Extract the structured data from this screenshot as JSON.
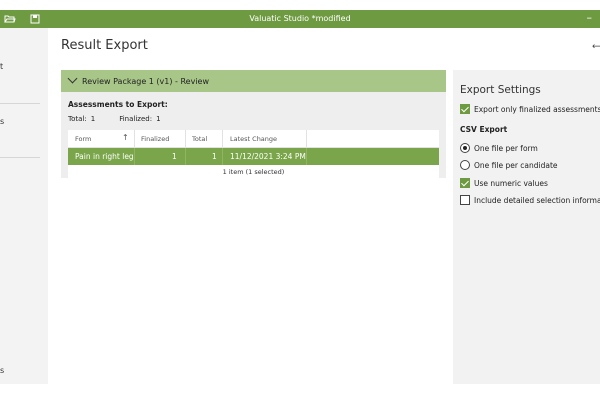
{
  "titlebar": {
    "title": "Valuatic Studio  *modified",
    "open_icon": "folder-open-icon",
    "save_icon": "save-icon",
    "minimize": "–"
  },
  "sidebar": {
    "fragments": [
      "t",
      "s",
      "s"
    ]
  },
  "main": {
    "page_title": "Result Export",
    "back_glyph": "⟵",
    "package": {
      "header": "Review Package 1 (v1) - Review",
      "assessments_label": "Assessments to Export:",
      "total_label": "Total:",
      "total_value": "1",
      "finalized_label": "Finalized:",
      "finalized_value": "1",
      "table": {
        "columns": [
          "Form",
          "Finalized",
          "Total",
          "Latest Change"
        ],
        "sort_indicator": "↑",
        "rows": [
          {
            "form": "Pain in right leg",
            "finalized": "1",
            "total": "1",
            "latest_change": "11/12/2021 3:24 PM"
          }
        ],
        "status": "1 item (1 selected)"
      }
    }
  },
  "export_settings": {
    "title": "Export Settings",
    "only_finalized": {
      "label": "Export only finalized assessments",
      "checked": true
    },
    "csv_heading": "CSV Export",
    "one_file_per_form": {
      "label": "One file per form",
      "selected": true
    },
    "one_file_per_candidate": {
      "label": "One file per candidate",
      "selected": false
    },
    "use_numeric_values": {
      "label": "Use numeric values",
      "checked": true
    },
    "include_detailed": {
      "label": "Include detailed selection information",
      "checked": false
    }
  },
  "colors": {
    "accent": "#6e9a41",
    "header_light": "#a9c689",
    "row_selected": "#7aa54a"
  }
}
